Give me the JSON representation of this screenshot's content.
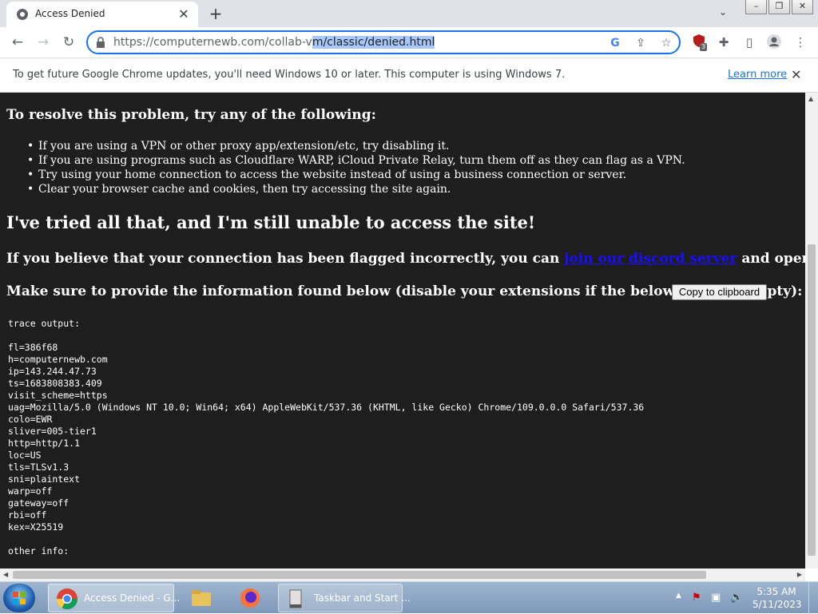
{
  "browser": {
    "tab_title": "Access Denied",
    "url_host": "https://computernewb.com",
    "url_path_plain": "/collab-v",
    "url_path_selected": "m/classic/denied.html",
    "extension_badge": "3"
  },
  "infobar": {
    "message": "To get future Google Chrome updates, you'll need Windows 10 or later. This computer is using Windows 7.",
    "learn_more": "Learn more"
  },
  "page": {
    "resolve_heading": "To resolve this problem, try any of the following:",
    "tips": [
      "If you are using a VPN or other proxy app/extension/etc, try disabling it.",
      "If you are using programs such as Cloudflare WARP, iCloud Private Relay, turn them off as they can flag as a VPN.",
      "Try using your home connection to access the website instead of using a business connection or server.",
      "Clear your browser cache and cookies, then try accessing the site again."
    ],
    "still_unable_heading": "I've tried all that, and I'm still unable to access the site!",
    "flagged_prefix": "If you believe that your connection has been flagged incorrectly, you can ",
    "flagged_link": "join our discord server",
    "flagged_suffix": " and open a ticket.",
    "provide_info": "Make sure to provide the information found below (disable your extensions if the below space is empty):",
    "copy_button": "Copy to clipboard",
    "trace_lines": [
      "trace output:",
      "",
      "fl=386f68",
      "h=computernewb.com",
      "ip=143.244.47.73",
      "ts=1683808383.409",
      "visit_scheme=https",
      "uag=Mozilla/5.0 (Windows NT 10.0; Win64; x64) AppleWebKit/537.36 (KHTML, like Gecko) Chrome/109.0.0.0 Safari/537.36",
      "colo=EWR",
      "sliver=005-tier1",
      "http=http/1.1",
      "loc=US",
      "tls=TLSv1.3",
      "sni=plaintext",
      "warp=off",
      "gateway=off",
      "rbi=off",
      "kex=X25519",
      "",
      "other info:"
    ]
  },
  "taskbar": {
    "chrome_label": "Access Denied - G...",
    "task_label": "Taskbar and Start ...",
    "time": "5:35 AM",
    "date": "5/11/2023"
  },
  "colors": {
    "page_background": "#1e1e1e",
    "link": "#1a0dff",
    "omnibox_focus": "#1a73e8",
    "selection": "#a8c7fa"
  }
}
